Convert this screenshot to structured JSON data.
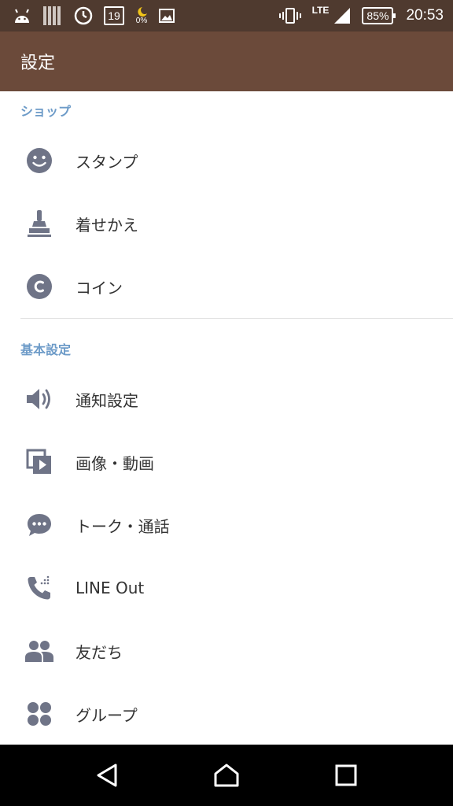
{
  "status_bar": {
    "left_icons": [
      "android-icon",
      "signal-bars-icon",
      "clock-icon",
      "calendar-icon",
      "moon-icon",
      "image-icon"
    ],
    "calendar_day": "19",
    "moon_percent": "0%",
    "network": "LTE",
    "battery": "85%",
    "time": "20:53"
  },
  "toolbar": {
    "title": "設定"
  },
  "sections": {
    "shop": {
      "header": "ショップ",
      "items": [
        {
          "label": "スタンプ",
          "icon": "smiley-icon"
        },
        {
          "label": "着せかえ",
          "icon": "brush-icon"
        },
        {
          "label": "コイン",
          "icon": "coin-icon"
        }
      ]
    },
    "basic": {
      "header": "基本設定",
      "items": [
        {
          "label": "通知設定",
          "icon": "speaker-icon"
        },
        {
          "label": "画像・動画",
          "icon": "media-icon"
        },
        {
          "label": "トーク・通話",
          "icon": "chat-icon"
        },
        {
          "label": "LINE Out",
          "icon": "phone-out-icon"
        },
        {
          "label": "友だち",
          "icon": "friends-icon"
        },
        {
          "label": "グループ",
          "icon": "group-icon"
        }
      ]
    }
  },
  "nav_bar": {
    "buttons": [
      "back-icon",
      "home-icon",
      "recents-icon"
    ]
  },
  "colors": {
    "status_bar": "#4f3a2f",
    "toolbar": "#6b4a3a",
    "section_header": "#6d9bc8",
    "icon_gray": "#6f7487",
    "label": "#333333"
  }
}
